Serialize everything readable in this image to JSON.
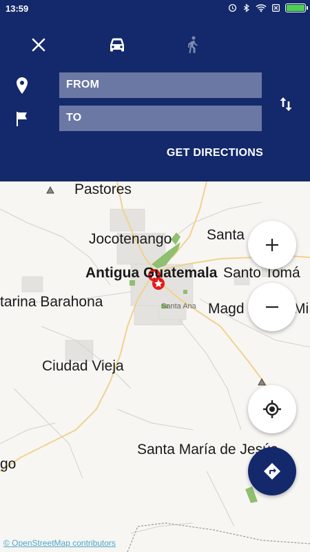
{
  "status_bar": {
    "time": "13:59",
    "icons": [
      "alarm-icon",
      "bluetooth-icon",
      "wifi-icon",
      "sim-icon",
      "battery-icon"
    ],
    "battery_level": 1.0
  },
  "directions_panel": {
    "modes": [
      {
        "name": "close",
        "icon": "close-icon"
      },
      {
        "name": "car",
        "icon": "car-icon",
        "selected": true
      },
      {
        "name": "walk",
        "icon": "walk-icon",
        "selected": false
      }
    ],
    "from_placeholder": "FROM",
    "to_placeholder": "TO",
    "get_directions_label": "GET DIRECTIONS",
    "colors": {
      "panel": "#14296b",
      "field": "#6a78a3"
    }
  },
  "map": {
    "places": [
      {
        "id": "pastores",
        "label": "Pastores"
      },
      {
        "id": "jocotenango",
        "label": "Jocotenango"
      },
      {
        "id": "santa",
        "label": "Santa"
      },
      {
        "id": "antigua",
        "label": "Antigua Guatemala"
      },
      {
        "id": "santo-tomas",
        "label": "Santo Tomá"
      },
      {
        "id": "barahona",
        "label": "tarina Barahona"
      },
      {
        "id": "santa-ana",
        "label": "Santa Ana"
      },
      {
        "id": "magdalena",
        "label": "Magd"
      },
      {
        "id": "mi",
        "label": "Mi"
      },
      {
        "id": "ciudad-vieja",
        "label": "Ciudad Vieja"
      },
      {
        "id": "santa-maria",
        "label": "Santa María de Jesús"
      },
      {
        "id": "go",
        "label": "go"
      }
    ],
    "attribution": "© OpenStreetMap contributors",
    "markers": [
      "marker-star-icon",
      "marker-star-icon"
    ]
  },
  "controls": {
    "zoom_in": "+",
    "zoom_out": "−",
    "locate_icon": "my-location-icon",
    "route_icon": "directions-icon"
  }
}
